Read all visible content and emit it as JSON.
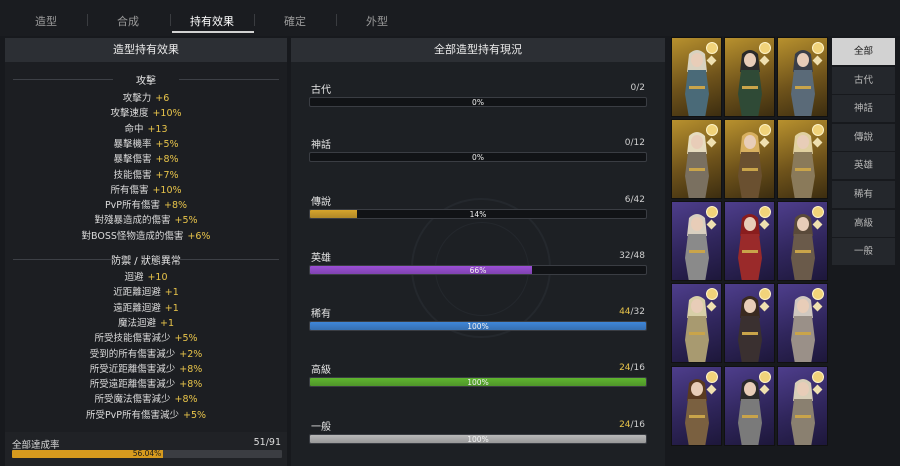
{
  "tabs": [
    {
      "label": "造型",
      "active": false
    },
    {
      "label": "合成",
      "active": false
    },
    {
      "label": "持有效果",
      "active": true
    },
    {
      "label": "確定",
      "active": false
    },
    {
      "label": "外型",
      "active": false
    }
  ],
  "left_panel": {
    "title": "造型持有效果",
    "sections": [
      {
        "title": "攻擊",
        "stats": [
          {
            "name": "攻擊力",
            "value": "+6"
          },
          {
            "name": "攻擊速度",
            "value": "+10%"
          },
          {
            "name": "命中",
            "value": "+13"
          },
          {
            "name": "暴擊機率",
            "value": "+5%"
          },
          {
            "name": "暴擊傷害",
            "value": "+8%"
          },
          {
            "name": "技能傷害",
            "value": "+7%"
          },
          {
            "name": "所有傷害",
            "value": "+10%"
          },
          {
            "name": "PvP所有傷害",
            "value": "+8%"
          },
          {
            "name": "對殘暴造成的傷害",
            "value": "+5%"
          },
          {
            "name": "對BOSS怪物造成的傷害",
            "value": "+6%"
          }
        ]
      },
      {
        "title": "防禦 / 狀態異常",
        "stats": [
          {
            "name": "迴避",
            "value": "+10"
          },
          {
            "name": "近距離迴避",
            "value": "+1"
          },
          {
            "name": "遠距離迴避",
            "value": "+1"
          },
          {
            "name": "魔法迴避",
            "value": "+1"
          },
          {
            "name": "所受技能傷害減少",
            "value": "+5%"
          },
          {
            "name": "受到的所有傷害減少",
            "value": "+2%"
          },
          {
            "name": "所受近距離傷害減少",
            "value": "+8%"
          },
          {
            "name": "所受遠距離傷害減少",
            "value": "+8%"
          },
          {
            "name": "所受魔法傷害減少",
            "value": "+8%"
          },
          {
            "name": "所受PvP所有傷害減少",
            "value": "+5%"
          }
        ]
      }
    ],
    "total": {
      "label": "全部達成率",
      "count": "51/91",
      "percent_text": "56.04%",
      "fraction": 0.5604
    }
  },
  "middle_panel": {
    "title": "全部造型持有現況",
    "rarities": [
      {
        "name": "古代",
        "owned": "",
        "count": "0/2",
        "percent": "0%",
        "fraction": 0.0,
        "color": "#8a8a8a",
        "full": false
      },
      {
        "name": "神話",
        "owned": "",
        "count": "0/12",
        "percent": "0%",
        "fraction": 0.0,
        "color": "#8a8a8a",
        "full": false
      },
      {
        "name": "傳說",
        "owned": "",
        "count": "6/42",
        "percent": "14%",
        "fraction": 0.14,
        "color": "#d7a52c",
        "full": false
      },
      {
        "name": "英雄",
        "owned": "",
        "count": "32/48",
        "percent": "66%",
        "fraction": 0.66,
        "color": "#9b4fd6",
        "full": false
      },
      {
        "name": "稀有",
        "owned": "44",
        "count": "/32",
        "percent": "100%",
        "fraction": 1.0,
        "color": "#3f86d8",
        "full": true
      },
      {
        "name": "高級",
        "owned": "24",
        "count": "/16",
        "percent": "100%",
        "fraction": 1.0,
        "color": "#5fb52f",
        "full": true
      },
      {
        "name": "一般",
        "owned": "24",
        "count": "/16",
        "percent": "100%",
        "fraction": 1.0,
        "color": "#b9b9b9",
        "full": true
      }
    ]
  },
  "portraits": [
    {
      "tier": "gold",
      "hair": "#d8d2c0",
      "armor": "#4a6a78"
    },
    {
      "tier": "gold",
      "hair": "#2a2a2a",
      "armor": "#2f4a36"
    },
    {
      "tier": "gold",
      "hair": "#3a3f48",
      "armor": "#5a6a78"
    },
    {
      "tier": "gold",
      "hair": "#e6dcc0",
      "armor": "#7a7060"
    },
    {
      "tier": "gold",
      "hair": "#d8b060",
      "armor": "#6a5030"
    },
    {
      "tier": "gold",
      "hair": "#e0d0a0",
      "armor": "#8a7a5a"
    },
    {
      "tier": "purple",
      "hair": "#d8cfc0",
      "armor": "#8a8a8a"
    },
    {
      "tier": "purple",
      "hair": "#8a1d1d",
      "armor": "#9a2a2a"
    },
    {
      "tier": "purple",
      "hair": "#5a4a3a",
      "armor": "#6a5a4a"
    },
    {
      "tier": "purple",
      "hair": "#d8cfa8",
      "armor": "#a89a70"
    },
    {
      "tier": "purple",
      "hair": "#3a2a20",
      "armor": "#3a3030"
    },
    {
      "tier": "purple",
      "hair": "#d0c8c0",
      "armor": "#9a9088"
    },
    {
      "tier": "purple",
      "hair": "#5a3a20",
      "armor": "#7a6040"
    },
    {
      "tier": "purple",
      "hair": "#2a2a2a",
      "armor": "#7a7a7a"
    },
    {
      "tier": "purple",
      "hair": "#d8cfb8",
      "armor": "#8a8070"
    }
  ],
  "filters": [
    {
      "label": "全部",
      "active": true
    },
    {
      "label": "古代",
      "active": false
    },
    {
      "label": "神話",
      "active": false
    },
    {
      "label": "傳說",
      "active": false
    },
    {
      "label": "英雄",
      "active": false
    },
    {
      "label": "稀有",
      "active": false
    },
    {
      "label": "高級",
      "active": false
    },
    {
      "label": "一般",
      "active": false
    }
  ]
}
